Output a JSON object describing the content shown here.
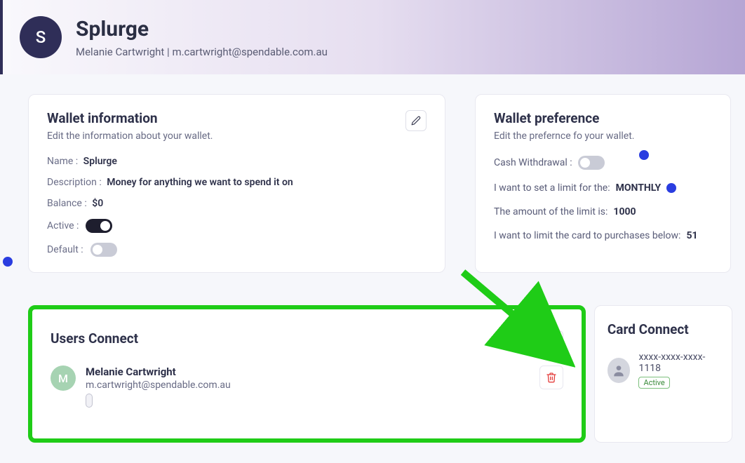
{
  "header": {
    "avatar_letter": "S",
    "title": "Splurge",
    "subtitle": "Melanie Cartwright | m.cartwright@spendable.com.au"
  },
  "wallet_info": {
    "title": "Wallet information",
    "subtitle": "Edit the information about your wallet.",
    "edit_icon": "pencil-icon",
    "name_label": "Name :",
    "name_value": "Splurge",
    "desc_label": "Description :",
    "desc_value": "Money for anything we want to spend it on",
    "balance_label": "Balance :",
    "balance_value": "$0",
    "active_label": "Active :",
    "active_on": true,
    "default_label": "Default :",
    "default_on": false
  },
  "wallet_pref": {
    "title": "Wallet preference",
    "subtitle": "Edit the prefernce fo your wallet.",
    "cash_label": "Cash Withdrawal :",
    "cash_on": false,
    "limit_label": "I want to set a limit for the:",
    "limit_value": "MONTHLY",
    "amount_label": "The amount of the limit is:",
    "amount_value": "1000",
    "below_label": "I want to limit the card to purchases below:",
    "below_value": "51"
  },
  "users_connect": {
    "title": "Users Connect",
    "add_icon": "plus-icon",
    "users": [
      {
        "avatar_letter": "M",
        "name": "Melanie Cartwright",
        "email": "m.cartwright@spendable.com.au"
      }
    ],
    "delete_icon": "trash-icon"
  },
  "card_connect": {
    "title": "Card Connect",
    "card_number": "xxxx-xxxx-xxxx-1118",
    "status": "Active"
  },
  "colors": {
    "accent_blue": "#2a3de0",
    "highlight_green": "#1fcc17",
    "status_green": "#3a8a3a"
  }
}
